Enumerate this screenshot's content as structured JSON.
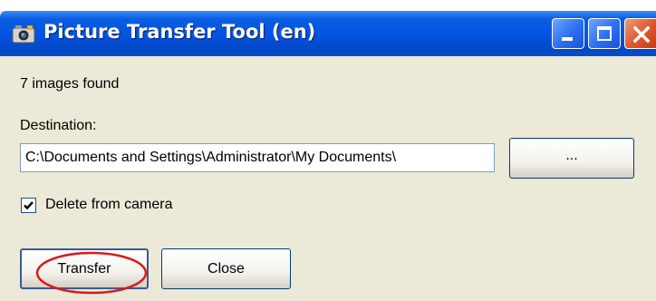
{
  "window": {
    "title": "Picture Transfer Tool (en)",
    "controls": [
      "minimize",
      "maximize",
      "close"
    ]
  },
  "status": {
    "text": "7 images found"
  },
  "destination": {
    "label": "Destination:",
    "value": "C:\\Documents and Settings\\Administrator\\My Documents\\",
    "browse_label": "..."
  },
  "options": {
    "delete_from_camera": {
      "label": "Delete from camera",
      "checked": true
    }
  },
  "buttons": {
    "transfer_label": "Transfer",
    "close_label": "Close"
  },
  "annotation": {
    "color": "#d9191c",
    "target": "transfer-button"
  },
  "colors": {
    "titlebar": "#0454e3",
    "window_bg": "#ece9d8",
    "close_btn": "#e0552c"
  },
  "icons": {
    "app": "camera-icon",
    "check": "checkmark-icon"
  }
}
